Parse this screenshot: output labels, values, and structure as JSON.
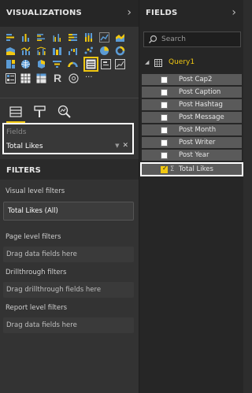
{
  "viz": {
    "title": "VISUALIZATIONS",
    "collapse_icon": "chevron-right-icon",
    "more_label": "...",
    "custom_visual_label": "R",
    "fields_well": {
      "label": "Fields",
      "value": "Total Likes"
    },
    "tabs": [
      "fields-tab",
      "format-tab",
      "analytics-tab"
    ]
  },
  "filters": {
    "title": "FILTERS",
    "visual_level_label": "Visual level filters",
    "visual_filter_card": "Total Likes  (All)",
    "page_level_label": "Page level filters",
    "page_level_drop": "Drag data fields here",
    "drillthrough_label": "Drillthrough filters",
    "drillthrough_drop": "Drag drillthrough fields here",
    "report_level_label": "Report level filters",
    "report_level_drop": "Drag data fields here"
  },
  "fields_pane": {
    "title": "FIELDS",
    "search_placeholder": "Search",
    "query_name": "Query1",
    "fields": [
      {
        "name": "Post Cap2",
        "checked": false
      },
      {
        "name": "Post Caption",
        "checked": false
      },
      {
        "name": "Post Hashtag",
        "checked": false
      },
      {
        "name": "Post Message",
        "checked": false
      },
      {
        "name": "Post Month",
        "checked": false
      },
      {
        "name": "Post Writer",
        "checked": false
      },
      {
        "name": "Post Year",
        "checked": false
      },
      {
        "name": "Total Likes",
        "checked": true,
        "sigma": "Σ"
      }
    ]
  },
  "colors": {
    "accent": "#f2c811",
    "panel": "#333333",
    "header": "#262626"
  }
}
